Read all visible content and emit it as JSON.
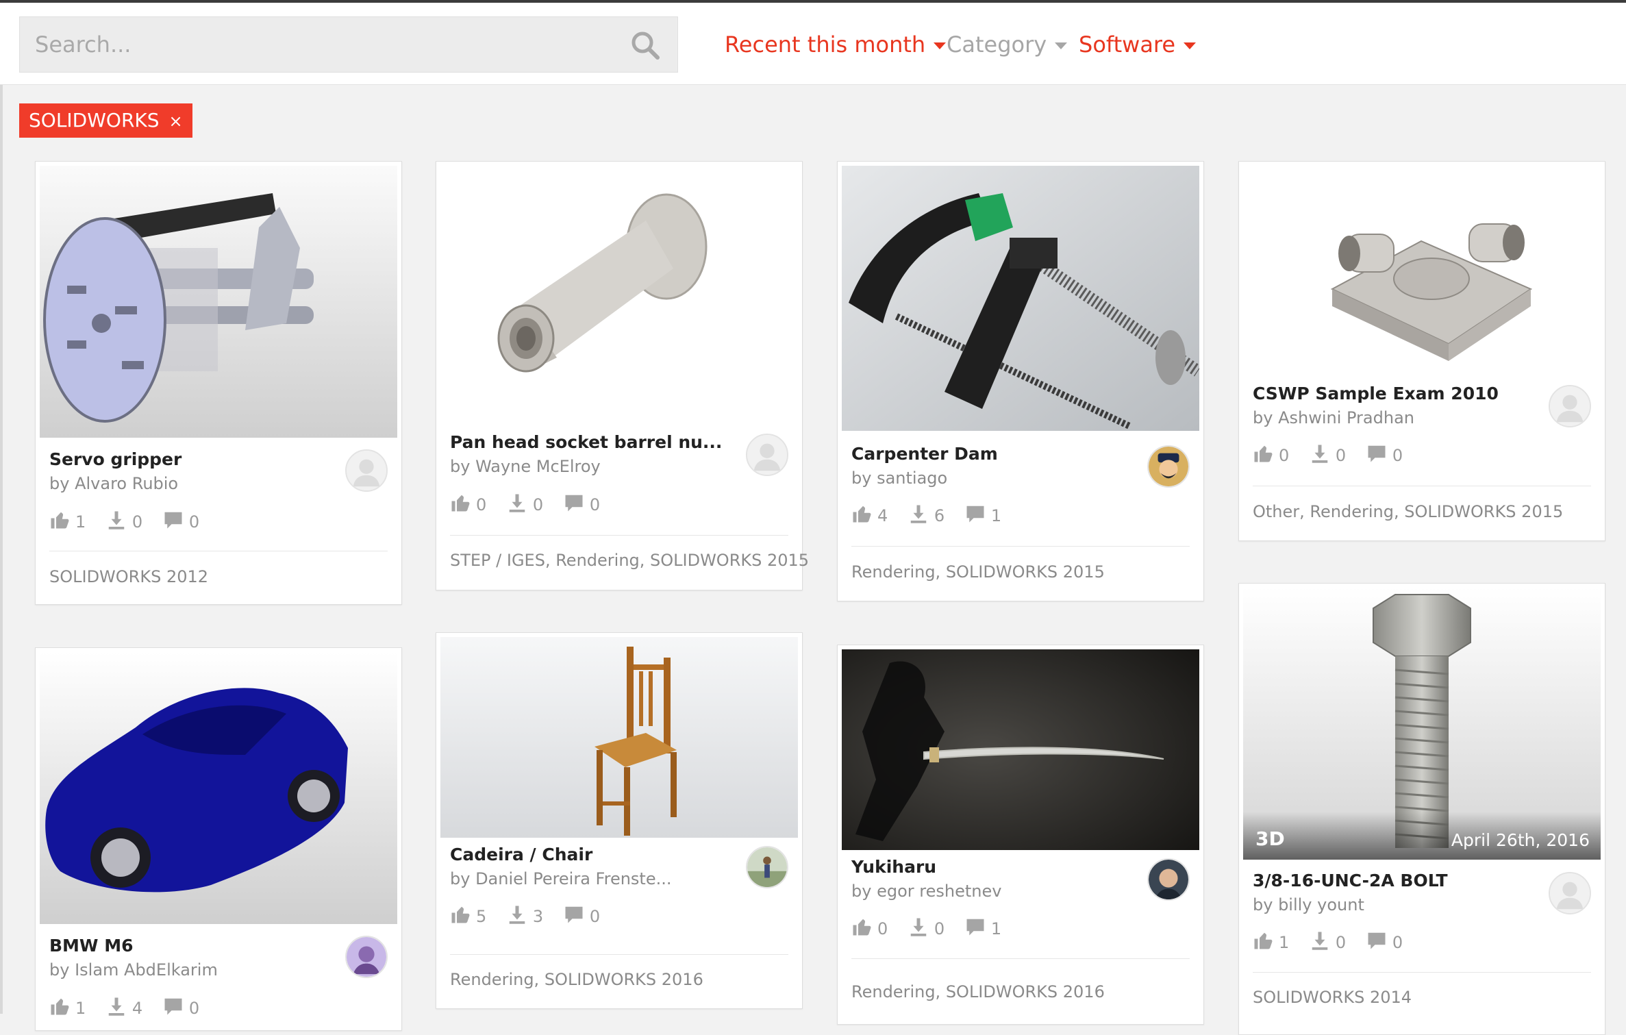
{
  "search": {
    "placeholder": "Search...",
    "icon": "search-icon"
  },
  "filters": [
    {
      "label": "Recent this month"
    },
    {
      "label": "Category"
    },
    {
      "label": "Software"
    }
  ],
  "active_tag": {
    "label": "SOLIDWORKS",
    "remove": "×"
  },
  "colors": {
    "accent": "#e8361f",
    "tag_bg": "#f03c2a",
    "muted": "#a6a6a6"
  },
  "cards": [
    {
      "title": "Servo gripper",
      "author": "by Alvaro Rubio",
      "likes": "1",
      "downloads": "0",
      "comments": "0",
      "tags": "SOLIDWORKS 2012"
    },
    {
      "title": "Pan head socket barrel nu...",
      "author": "by Wayne McElroy",
      "likes": "0",
      "downloads": "0",
      "comments": "0",
      "tags": "STEP / IGES, Rendering, SOLIDWORKS 2015"
    },
    {
      "title": "Carpenter Dam",
      "author": "by santiago",
      "likes": "4",
      "downloads": "6",
      "comments": "1",
      "tags": "Rendering, SOLIDWORKS 2015"
    },
    {
      "title": "CSWP Sample Exam 2010",
      "author": "by Ashwini Pradhan",
      "likes": "0",
      "downloads": "0",
      "comments": "0",
      "tags": "Other, Rendering, SOLIDWORKS 2015"
    },
    {
      "title": "BMW M6",
      "author": "by Islam AbdElkarim",
      "likes": "1",
      "downloads": "4",
      "comments": "0",
      "tags": ""
    },
    {
      "title": "Cadeira / Chair",
      "author": "by Daniel Pereira Frenste...",
      "likes": "5",
      "downloads": "3",
      "comments": "0",
      "tags": "Rendering, SOLIDWORKS 2016"
    },
    {
      "title": "Yukiharu",
      "author": "by egor reshetnev",
      "likes": "0",
      "downloads": "0",
      "comments": "1",
      "tags": "Rendering, SOLIDWORKS 2016"
    },
    {
      "title": "3/8-16-UNC-2A BOLT",
      "author": "by billy yount",
      "likes": "1",
      "downloads": "0",
      "comments": "0",
      "tags": "SOLIDWORKS 2014",
      "badge": "3D",
      "date": "April 26th, 2016"
    }
  ]
}
